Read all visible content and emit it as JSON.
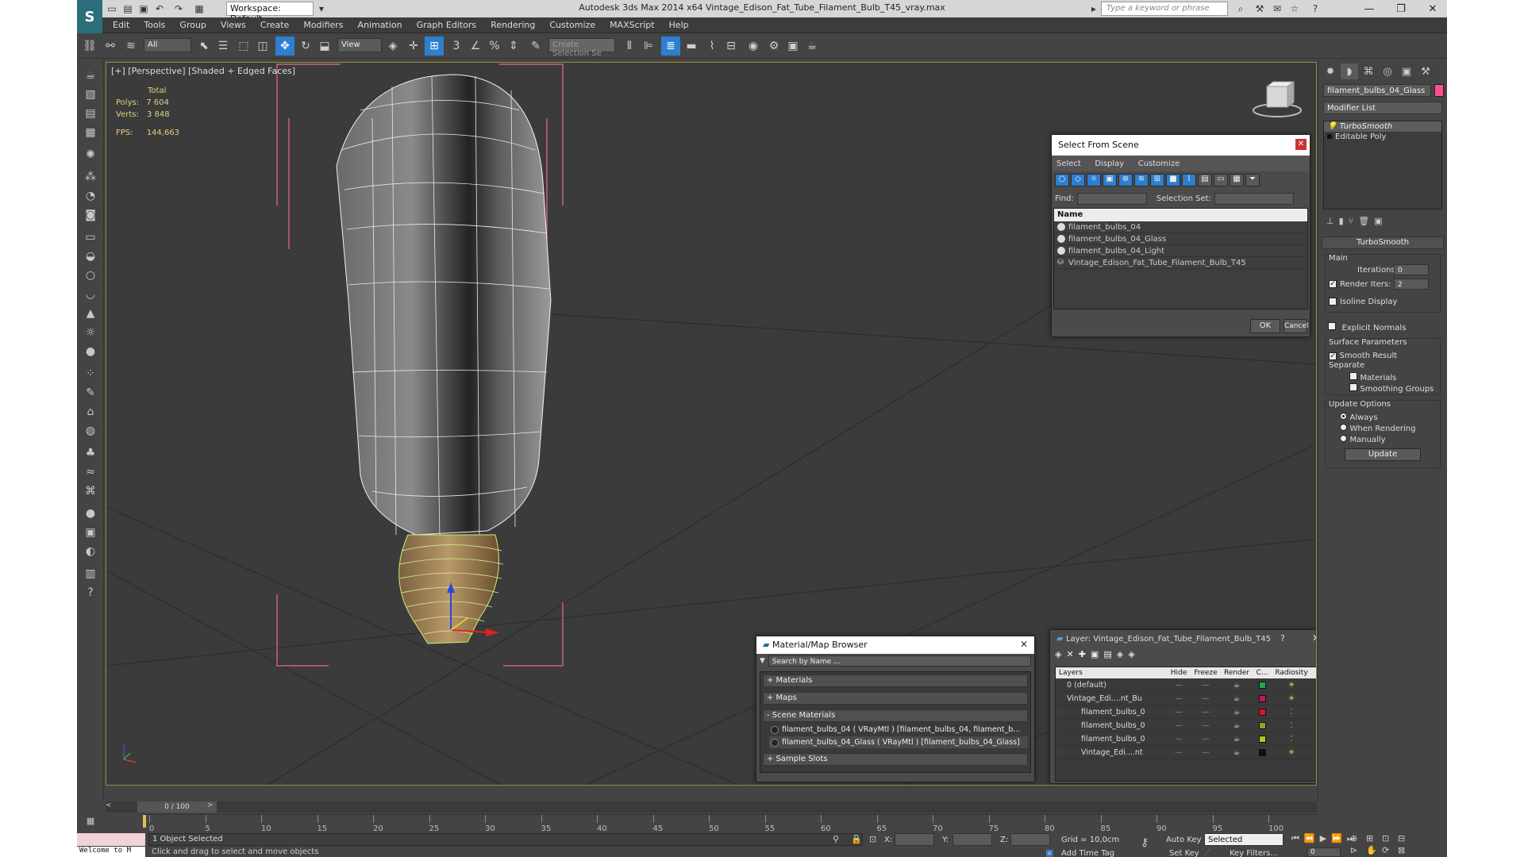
{
  "window": {
    "title": "Autodesk 3ds Max  2014 x64     Vintage_Edison_Fat_Tube_Filament_Bulb_T45_vray.max",
    "workspace": "Workspace: Default",
    "search_placeholder": "Type a keyword or phrase"
  },
  "menu": [
    "Edit",
    "Tools",
    "Group",
    "Views",
    "Create",
    "Modifiers",
    "Animation",
    "Graph Editors",
    "Rendering",
    "Customize",
    "MAXScript",
    "Help"
  ],
  "toolbar": {
    "filter_value": "All",
    "refcoord_value": "View",
    "selection_set_placeholder": "Create Selection Se"
  },
  "viewport": {
    "label": "[+] [Perspective] [Shaded + Edged Faces]",
    "stats_total": "Total",
    "polys_label": "Polys:",
    "polys_value": "7 604",
    "verts_label": "Verts:",
    "verts_value": "3 848",
    "fps_label": "FPS:",
    "fps_value": "144,663"
  },
  "select_from_scene": {
    "title": "Select From Scene",
    "menu": [
      "Select",
      "Display",
      "Customize"
    ],
    "find_label": "Find:",
    "selection_set_label": "Selection Set:",
    "column_name": "Name",
    "items": [
      "filament_bulbs_04",
      "filament_bulbs_04_Glass",
      "filament_bulbs_04_Light",
      "Vintage_Edison_Fat_Tube_Filament_Bulb_T45"
    ],
    "ok": "OK",
    "cancel": "Cancel"
  },
  "material_browser": {
    "title": "Material/Map Browser",
    "search_placeholder": "Search by Name ...",
    "sections": {
      "materials": "+ Materials",
      "maps": "+ Maps",
      "scene_materials": "- Scene Materials",
      "sample_slots": "+ Sample Slots"
    },
    "scene_materials": [
      "filament_bulbs_04 ( VRayMtl ) [filament_bulbs_04, filament_b...",
      "filament_bulbs_04_Glass ( VRayMtl ) [filament_bulbs_04_Glass]"
    ]
  },
  "layer_dialog": {
    "title": "Layer: Vintage_Edison_Fat_Tube_Filament_Bulb_T45",
    "help": "?",
    "columns": [
      "Layers",
      "Hide",
      "Freeze",
      "Render",
      "C...",
      "Radiosity"
    ],
    "rows": [
      {
        "name": "0 (default)",
        "color": "#22aa44"
      },
      {
        "name": "Vintage_Edi....nt_Bu",
        "color": "#cc1166"
      },
      {
        "name": "filament_bulbs_0",
        "color": "#dd1133"
      },
      {
        "name": "filament_bulbs_0",
        "color": "#88aa22"
      },
      {
        "name": "filament_bulbs_0",
        "color": "#aacc22"
      },
      {
        "name": "Vintage_Edi....nt",
        "color": "#111111"
      }
    ]
  },
  "command_panel": {
    "object_name": "filament_bulbs_04_Glass",
    "object_color": "#ff4d94",
    "modifier_list": "Modifier List",
    "stack": [
      "TurboSmooth",
      "Editable Poly"
    ],
    "turbosmooth": {
      "rollout": "TurboSmooth",
      "main": "Main",
      "iterations_label": "Iterations:",
      "iterations_value": "0",
      "render_iters_label": "Render Iters:",
      "render_iters_value": "2",
      "isoline": "Isoline Display",
      "explicit": "Explicit Normals",
      "surface_params": "Surface Parameters",
      "smooth_result": "Smooth Result",
      "separate": "Separate",
      "materials": "Materials",
      "smoothing_groups": "Smoothing Groups",
      "update_options": "Update Options",
      "always": "Always",
      "when_rendering": "When Rendering",
      "manually": "Manually",
      "update_button": "Update"
    }
  },
  "timeline": {
    "frame_counter": "0 / 100",
    "ticks": [
      "0",
      "5",
      "10",
      "15",
      "20",
      "25",
      "30",
      "35",
      "40",
      "45",
      "50",
      "55",
      "60",
      "65",
      "70",
      "75",
      "80",
      "85",
      "90",
      "95",
      "100"
    ]
  },
  "status": {
    "script_listener": "Welcome to M",
    "selected": "1 Object Selected",
    "prompt": "Click and drag to select and move objects",
    "x_label": "X:",
    "y_label": "Y:",
    "z_label": "Z:",
    "grid": "Grid = 10,0cm",
    "add_time_tag": "Add Time Tag",
    "auto_key": "Auto Key",
    "set_key": "Set Key",
    "selected_dropdown": "Selected",
    "key_filters": "Key Filters...",
    "frame": "0"
  }
}
